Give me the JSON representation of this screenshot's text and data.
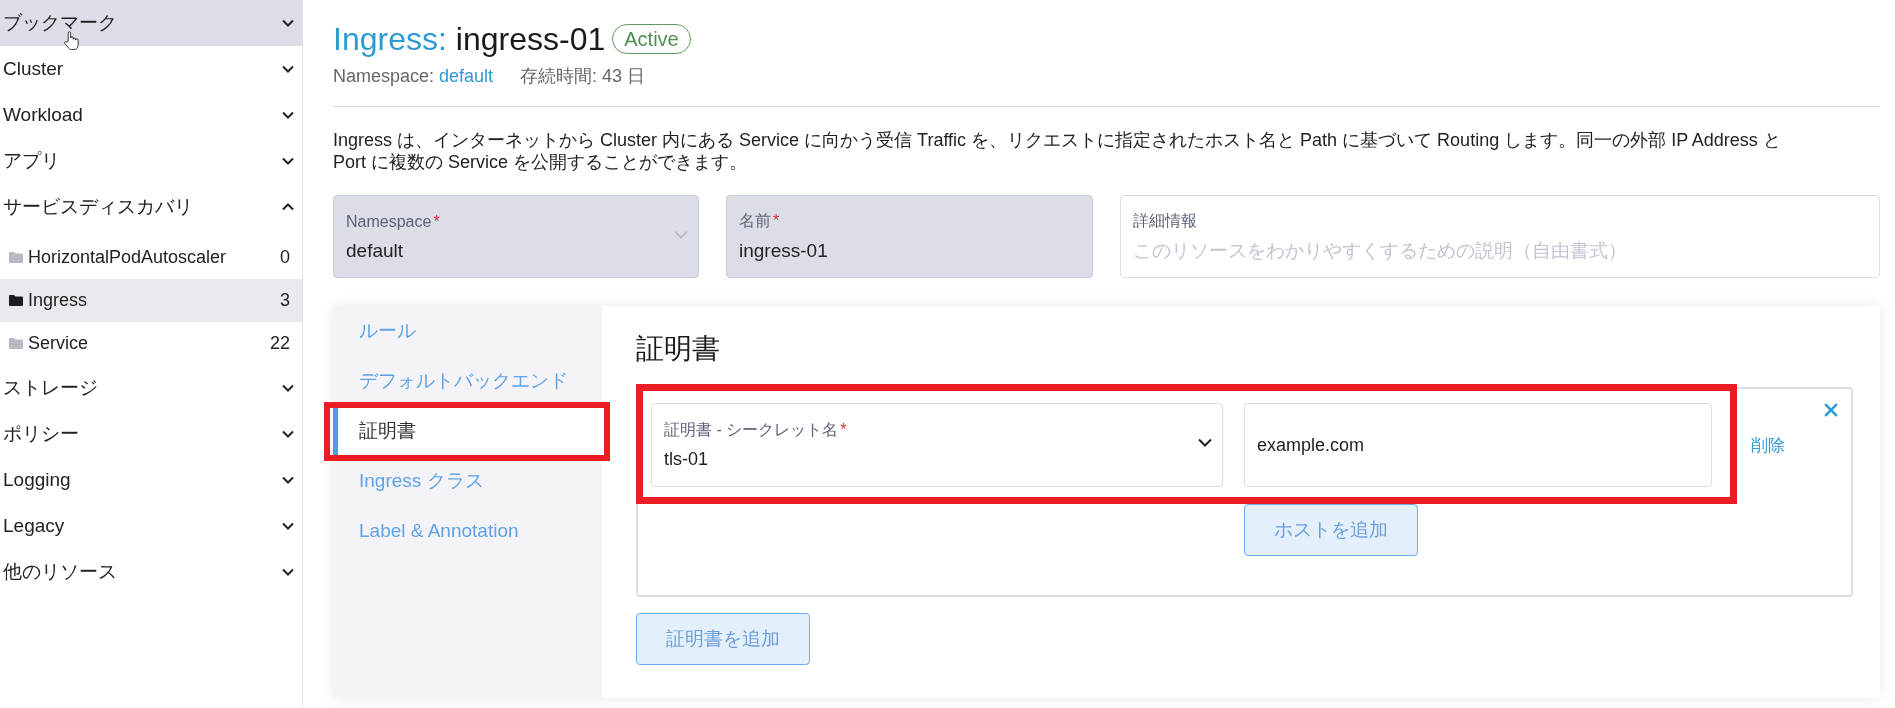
{
  "sidebar": {
    "items": [
      {
        "label": "ブックマーク",
        "expanded": false,
        "hovered": true
      },
      {
        "label": "Cluster",
        "expanded": false,
        "hovered": false
      },
      {
        "label": "Workload",
        "expanded": false,
        "hovered": false
      },
      {
        "label": "アプリ",
        "expanded": false,
        "hovered": false
      },
      {
        "label": "サービスディスカバリ",
        "expanded": true,
        "hovered": false,
        "children": [
          {
            "label": "HorizontalPodAutoscaler",
            "count": "0",
            "selected": false
          },
          {
            "label": "Ingress",
            "count": "3",
            "selected": true
          },
          {
            "label": "Service",
            "count": "22",
            "selected": false
          }
        ]
      },
      {
        "label": "ストレージ",
        "expanded": false,
        "hovered": false
      },
      {
        "label": "ポリシー",
        "expanded": false,
        "hovered": false
      },
      {
        "label": "Logging",
        "expanded": false,
        "hovered": false
      },
      {
        "label": "Legacy",
        "expanded": false,
        "hovered": false
      },
      {
        "label": "他のリソース",
        "expanded": false,
        "hovered": false
      }
    ]
  },
  "header": {
    "resource_type": "Ingress:",
    "name": "ingress-01",
    "status": "Active",
    "namespace_label": "Namespace:",
    "namespace": "default",
    "age": "存続時間: 43 日"
  },
  "description": "Ingress は、インターネットから Cluster 内にある Service に向かう受信 Traffic を、リクエストに指定されたホスト名と Path に基づいて Routing します。同一の外部 IP Address と Port に複数の Service を公開することができます。",
  "fields": [
    {
      "kind": "select",
      "label": "Namespace",
      "required_mark": "*",
      "value": "default",
      "disabled": true
    },
    {
      "kind": "text",
      "label": "名前",
      "required_mark": "*",
      "value": "ingress-01",
      "disabled": true
    },
    {
      "kind": "text",
      "label": "詳細情報",
      "placeholder": "このリソースをわかりやすくするための説明（自由書式）",
      "disabled": false
    }
  ],
  "tabs": [
    {
      "label": "ルール",
      "selected": false,
      "framed": false
    },
    {
      "label": "デフォルトバックエンド",
      "selected": false,
      "framed": false
    },
    {
      "label": "証明書",
      "selected": true,
      "framed": true
    },
    {
      "label": "Ingress クラス",
      "selected": false,
      "framed": false
    },
    {
      "label": "Label & Annotation",
      "selected": false,
      "framed": false
    }
  ],
  "certificates": {
    "title": "証明書",
    "entries": [
      {
        "framed": true,
        "secret": {
          "label": "証明書 - シークレット名",
          "required_mark": "*",
          "value": "tls-01"
        },
        "hosts": [
          {
            "value": "example.com",
            "remove": "削除"
          }
        ],
        "add_host": "ホストを追加"
      }
    ],
    "add_button": "証明書を追加"
  }
}
